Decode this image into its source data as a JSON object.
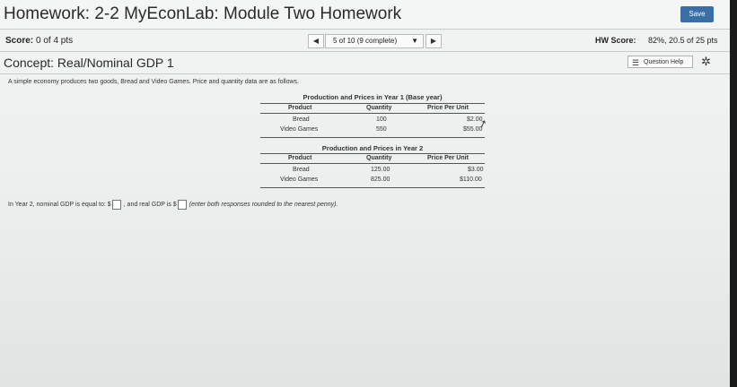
{
  "header": {
    "title": "Homework: 2-2 MyEconLab: Module Two Homework",
    "save_label": "Save"
  },
  "score_bar": {
    "score_label": "Score:",
    "score_value": "0 of 4 pts",
    "question_nav": "5 of 10 (9 complete)",
    "prev_icon": "◀",
    "next_icon": "▶",
    "dropdown_icon": "▼",
    "hw_score_label": "HW Score:",
    "hw_score_value": "82%, 20.5 of 25 pts"
  },
  "concept_bar": {
    "title": "Concept: Real/Nominal GDP 1",
    "help_label": "Question Help",
    "help_icon": "list-icon",
    "settings_icon": "gear-icon"
  },
  "content": {
    "intro": "A simple economy produces two goods, Bread and Video Games. Price and quantity data are as follows.",
    "table1": {
      "caption": "Production and Prices in Year 1 (Base year)",
      "headers": [
        "Product",
        "Quantity",
        "Price Per Unit"
      ],
      "rows": [
        [
          "Bread",
          "100",
          "$2.00"
        ],
        [
          "Video Games",
          "550",
          "$55.00"
        ]
      ]
    },
    "table2": {
      "caption": "Production and Prices in Year 2",
      "headers": [
        "Product",
        "Quantity",
        "Price Per Unit"
      ],
      "rows": [
        [
          "Bread",
          "125.00",
          "$3.00"
        ],
        [
          "Video Games",
          "825.00",
          "$110.00"
        ]
      ]
    },
    "question": {
      "part1": "In Year 2, nominal GDP is equal to: $",
      "part2": ", and real GDP is $",
      "hint": "(enter both responses rounded to the nearest penny)."
    }
  },
  "colors": {
    "save_button": "#3a6ea6",
    "background": "#eceeee"
  }
}
